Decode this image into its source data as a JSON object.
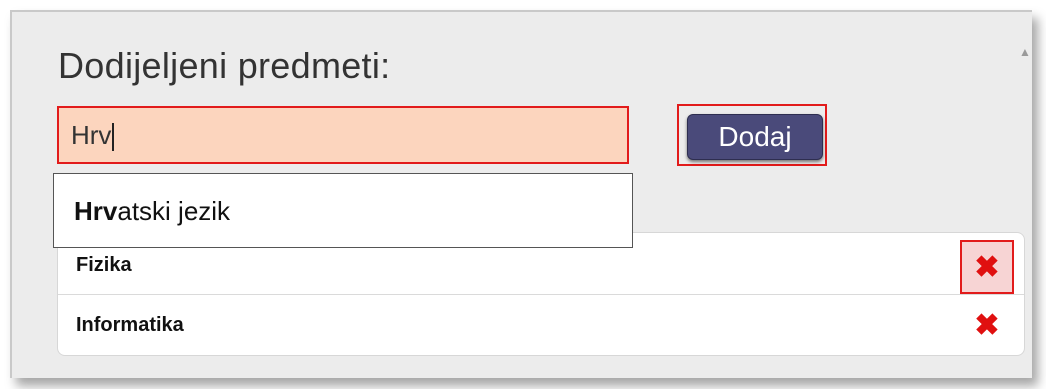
{
  "section": {
    "title": "Dodijeljeni predmeti:"
  },
  "search": {
    "value": "Hrv",
    "placeholder": ""
  },
  "add_button": {
    "label": "Dodaj"
  },
  "autocomplete": {
    "match": "Hrv",
    "rest": "atski jezik"
  },
  "subjects": [
    {
      "label": "Fizika",
      "remove_icon": "✖"
    },
    {
      "label": "Informatika",
      "remove_icon": "✖"
    }
  ],
  "colors": {
    "input_bg": "#fcd5be",
    "highlight_border": "#e21b1b",
    "button_bg": "#4a4a7a",
    "remove_icon": "#e01010"
  },
  "icons": {
    "remove": "close-icon",
    "scroll_up": "scroll-up-icon"
  }
}
